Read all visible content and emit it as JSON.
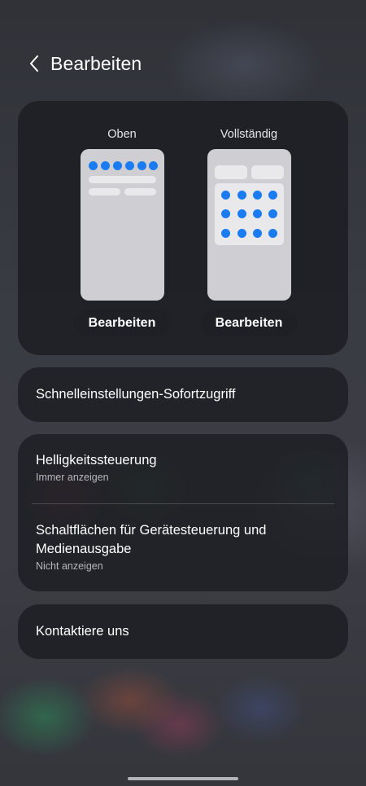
{
  "header": {
    "back_icon": "chevron-left-icon",
    "title": "Bearbeiten"
  },
  "preview": {
    "layouts": [
      {
        "label": "Oben",
        "button_label": "Bearbeiten"
      },
      {
        "label": "Vollständig",
        "button_label": "Bearbeiten"
      }
    ],
    "accent_color": "#1b7cf2"
  },
  "quick_access": {
    "label": "Schnelleinstellungen-Sofortzugriff"
  },
  "settings": {
    "brightness": {
      "title": "Helligkeitssteuerung",
      "value": "Immer anzeigen"
    },
    "device_media": {
      "title": "Schaltflächen für Gerätesteuerung und Medienausgabe",
      "value": "Nicht anzeigen"
    }
  },
  "contact": {
    "label": "Kontaktiere uns"
  }
}
